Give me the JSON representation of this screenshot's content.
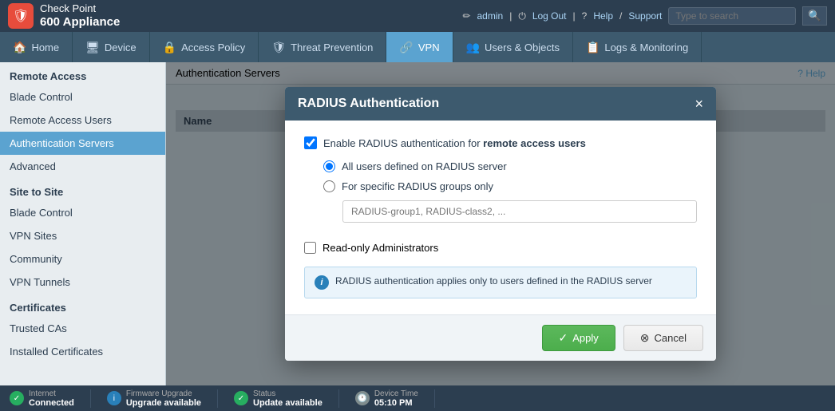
{
  "app": {
    "logo_icon": "🛡",
    "brand": "Check Point",
    "model": "600 Appliance"
  },
  "topbar": {
    "user": "admin",
    "logout": "Log Out",
    "help": "Help",
    "support": "Support",
    "search_placeholder": "Type to search"
  },
  "nav": {
    "tabs": [
      {
        "id": "home",
        "label": "Home",
        "icon": "🏠",
        "active": false
      },
      {
        "id": "device",
        "label": "Device",
        "icon": "🖥",
        "active": false
      },
      {
        "id": "access-policy",
        "label": "Access Policy",
        "icon": "🔒",
        "active": false
      },
      {
        "id": "threat-prevention",
        "label": "Threat Prevention",
        "icon": "🛡",
        "active": false
      },
      {
        "id": "vpn",
        "label": "VPN",
        "icon": "🔗",
        "active": true
      },
      {
        "id": "users-objects",
        "label": "Users & Objects",
        "icon": "👥",
        "active": false
      },
      {
        "id": "logs-monitoring",
        "label": "Logs & Monitoring",
        "icon": "📋",
        "active": false
      }
    ]
  },
  "sidebar": {
    "sections": [
      {
        "title": "Remote Access",
        "items": [
          {
            "id": "blade-control-ra",
            "label": "Blade Control",
            "active": false
          },
          {
            "id": "remote-access-users",
            "label": "Remote Access Users",
            "active": false
          },
          {
            "id": "authentication-servers",
            "label": "Authentication Servers",
            "active": true
          },
          {
            "id": "advanced",
            "label": "Advanced",
            "active": false
          }
        ]
      },
      {
        "title": "Site to Site",
        "items": [
          {
            "id": "blade-control-sts",
            "label": "Blade Control",
            "active": false
          },
          {
            "id": "vpn-sites",
            "label": "VPN Sites",
            "active": false
          },
          {
            "id": "community",
            "label": "Community",
            "active": false
          },
          {
            "id": "vpn-tunnels",
            "label": "VPN Tunnels",
            "active": false
          }
        ]
      },
      {
        "title": "Certificates",
        "items": [
          {
            "id": "trusted-cas",
            "label": "Trusted CAs",
            "active": false
          },
          {
            "id": "installed-certificates",
            "label": "Installed Certificates",
            "active": false
          }
        ]
      }
    ]
  },
  "content": {
    "header": "Authentication Servers",
    "help_label": "Help",
    "table_header": "Name"
  },
  "modal": {
    "title": "RADIUS Authentication",
    "close_label": "×",
    "enable_checkbox_label": "Enable RADIUS authentication for ",
    "enable_checkbox_bold": "remote access users",
    "radio_all_users": "All users defined on RADIUS server",
    "radio_specific_groups": "For specific RADIUS groups only",
    "groups_placeholder": "RADIUS-group1, RADIUS-class2, ...",
    "readonly_admins_label": "Read-only Administrators",
    "info_text": "RADIUS authentication applies only to users defined in the RADIUS server",
    "apply_label": "Apply",
    "cancel_label": "Cancel"
  },
  "statusbar": {
    "items": [
      {
        "id": "internet",
        "icon_type": "green",
        "icon_char": "✓",
        "label": "Internet",
        "value": "Connected"
      },
      {
        "id": "firmware",
        "icon_type": "blue",
        "icon_char": "i",
        "label": "Firmware Upgrade",
        "value": "Upgrade available"
      },
      {
        "id": "status",
        "icon_type": "green",
        "icon_char": "✓",
        "label": "Status",
        "value": "Update available"
      },
      {
        "id": "device-time",
        "icon_type": "clock",
        "icon_char": "🕐",
        "label": "Device Time",
        "value": "05:10 PM"
      }
    ]
  }
}
